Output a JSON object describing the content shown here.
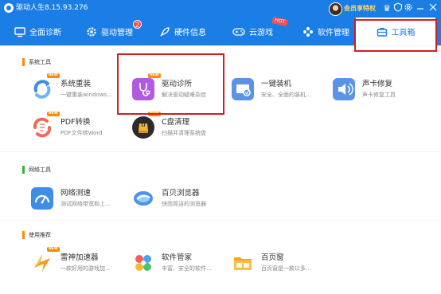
{
  "window": {
    "title": "驱动人生8.15.93.276"
  },
  "titlebar": {
    "vip_label": "会员享特权"
  },
  "nav": {
    "items": [
      {
        "key": "home",
        "label": "全面诊断",
        "icon": "monitor-icon"
      },
      {
        "key": "driver",
        "label": "驱动管理",
        "icon": "gear-icon",
        "badge": "2"
      },
      {
        "key": "hardware",
        "label": "硬件信息",
        "icon": "rocket-icon"
      },
      {
        "key": "cloudgame",
        "label": "云游戏",
        "icon": "gamepad-icon",
        "tag": "HOT"
      },
      {
        "key": "software",
        "label": "软件管理",
        "icon": "apps-icon"
      },
      {
        "key": "toolbox",
        "label": "工具箱",
        "icon": "toolbox-icon",
        "active": true
      }
    ]
  },
  "sections": {
    "system": {
      "title": "系统工具",
      "tools": [
        {
          "name": "系统重装",
          "desc": "一键重装windows...",
          "icon": "reinstall-icon",
          "tag": "NEW"
        },
        {
          "name": "驱动诊所",
          "desc": "解决驱动疑难杂症",
          "icon": "clinic-icon",
          "tag": "NEW"
        },
        {
          "name": "一键装机",
          "desc": "安全、全面的装机...",
          "icon": "install-icon"
        },
        {
          "name": "声卡修复",
          "desc": "声卡修复工具",
          "icon": "speaker-icon"
        },
        {
          "name": "PDF转换",
          "desc": "PDF文件转Word",
          "icon": "pdf-icon",
          "tag": "NEW"
        },
        {
          "name": "C盘清理",
          "desc": "扫描并清理系统盘",
          "icon": "disk-clean-icon",
          "tag": "NEW"
        }
      ]
    },
    "network": {
      "title": "网络工具",
      "tools": [
        {
          "name": "网络测速",
          "desc": "测试网络带宽和上...",
          "icon": "speedtest-icon"
        },
        {
          "name": "百贝浏览器",
          "desc": "快而简洁的浏览器",
          "icon": "browser-icon"
        }
      ]
    },
    "recommend": {
      "title": "使用推荐",
      "tools": [
        {
          "name": "雷神加速器",
          "desc": "一款好用的游戏加...",
          "icon": "accelerator-icon",
          "tag": "NEW"
        },
        {
          "name": "软件管家",
          "desc": "丰富、安全的软件...",
          "icon": "software-manager-icon"
        },
        {
          "name": "百页窗",
          "desc": "百页窗是一款以多...",
          "icon": "folder-icon"
        }
      ]
    }
  },
  "colors": {
    "brand": "#1a7ee6",
    "highlight": "#d11f1f",
    "new_tag": "#ff8a00"
  }
}
